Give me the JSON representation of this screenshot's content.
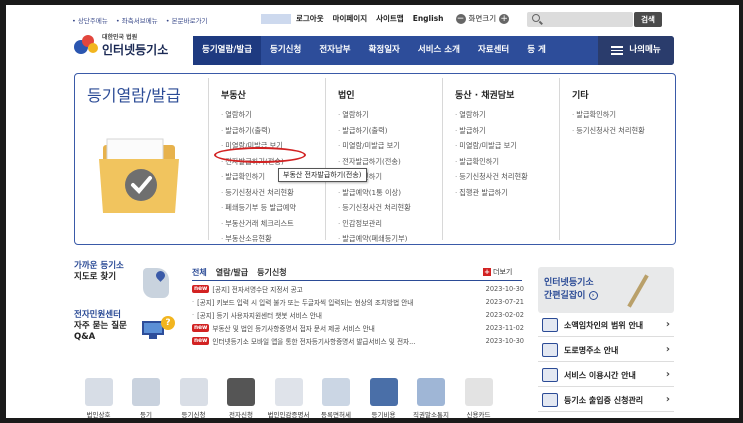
{
  "util": {
    "left_links": [
      "• 상단주메뉴",
      "• 좌측서브메뉴",
      "• 본문바로가기"
    ],
    "right_links": [
      "로그아웃",
      "마이페이지",
      "사이트맵",
      "English"
    ],
    "zoom_label": "화면크기"
  },
  "search": {
    "button": "검색",
    "placeholder": ""
  },
  "logo": {
    "sub": "대한민국 법원",
    "main": "인터넷등기소"
  },
  "nav": {
    "items": [
      "등기열람/발급",
      "등기신청",
      "전자납부",
      "확정일자",
      "서비스 소개",
      "자료센터",
      "등 게"
    ],
    "menu": "나의메뉴"
  },
  "mega": {
    "title": "등기열람/발급",
    "columns": [
      {
        "title": "부동산",
        "items": [
          "열람하기",
          "발급하기(출력)",
          "미열람/미발급 보기",
          "전자발급하기(전송)",
          "발급확인하기",
          "등기신청사건 처리현황",
          "폐쇄등기부 등 발급예약",
          "부동산거래 체크리스트",
          "부동산소유현황"
        ]
      },
      {
        "title": "법인",
        "items": [
          "열람하기",
          "발급하기(출력)",
          "미열람/미발급 보기",
          "전자발급하기(전송)",
          "발급확인하기",
          "발급예약(1통 이상)",
          "등기신청사건 처리현황",
          "인감정보관리",
          "발급예약(폐쇄등기부)"
        ]
      },
      {
        "title": "동산 · 채권담보",
        "items": [
          "열람하기",
          "발급하기",
          "미열람/미발급 보기",
          "발급확인하기",
          "등기신청사건 처리현황",
          "집행관 발급하기"
        ]
      },
      {
        "title": "기타",
        "items": [
          "발급확인하기",
          "등기신청사건 처리현황"
        ]
      }
    ],
    "tooltip": "부동산 전자발급하기(전송)"
  },
  "guide": {
    "near_l1": "가까운 등기소",
    "near_l2": "지도로 찾기",
    "center": "전자민원센터",
    "faq_l1": "자주 묻는 질문",
    "faq_l2": "Q&A"
  },
  "notices": {
    "tabs": [
      "전체",
      "열람/발급",
      "등기신청"
    ],
    "more": "더보기",
    "new_label": "new",
    "items": [
      {
        "new": true,
        "title": "[공지] 전자서명수단 지정서 공고",
        "date": "2023-10-30"
      },
      {
        "new": false,
        "title": "[공지] 키보드 입력 시 입력 불가 또는 두글자씩 입력되는 현상의 조치방법 안내",
        "date": "2023-07-21"
      },
      {
        "new": false,
        "title": "[공지] 등기 사용자지원센터 챗봇 서비스 안내",
        "date": "2023-02-02"
      },
      {
        "new": true,
        "title": "부동산 및 법인 등기사항증명서 접자 문서 제공 서비스 안내",
        "date": "2023-11-02"
      },
      {
        "new": true,
        "title": "인터넷등기소 모바일 앱을 통한 전자등기사항증명서 발급서비스 및 전자...",
        "date": "2023-10-30"
      }
    ]
  },
  "promo": {
    "l1": "인터넷등기소",
    "l2": "간편길잡이"
  },
  "quick": [
    "소액임차인의 범위 안내",
    "도로명주소 안내",
    "서비스 이용시간 안내",
    "등기소 출입증 신청관리"
  ],
  "icons": [
    "법인상호",
    "등기",
    "등기신청",
    "전자신청",
    "법인인감증명서",
    "등록면허세",
    "등기비용",
    "직권말소통지",
    "신용카드"
  ],
  "colors": {
    "brand": "#2d4d9a",
    "accent_red": "#d22222"
  }
}
